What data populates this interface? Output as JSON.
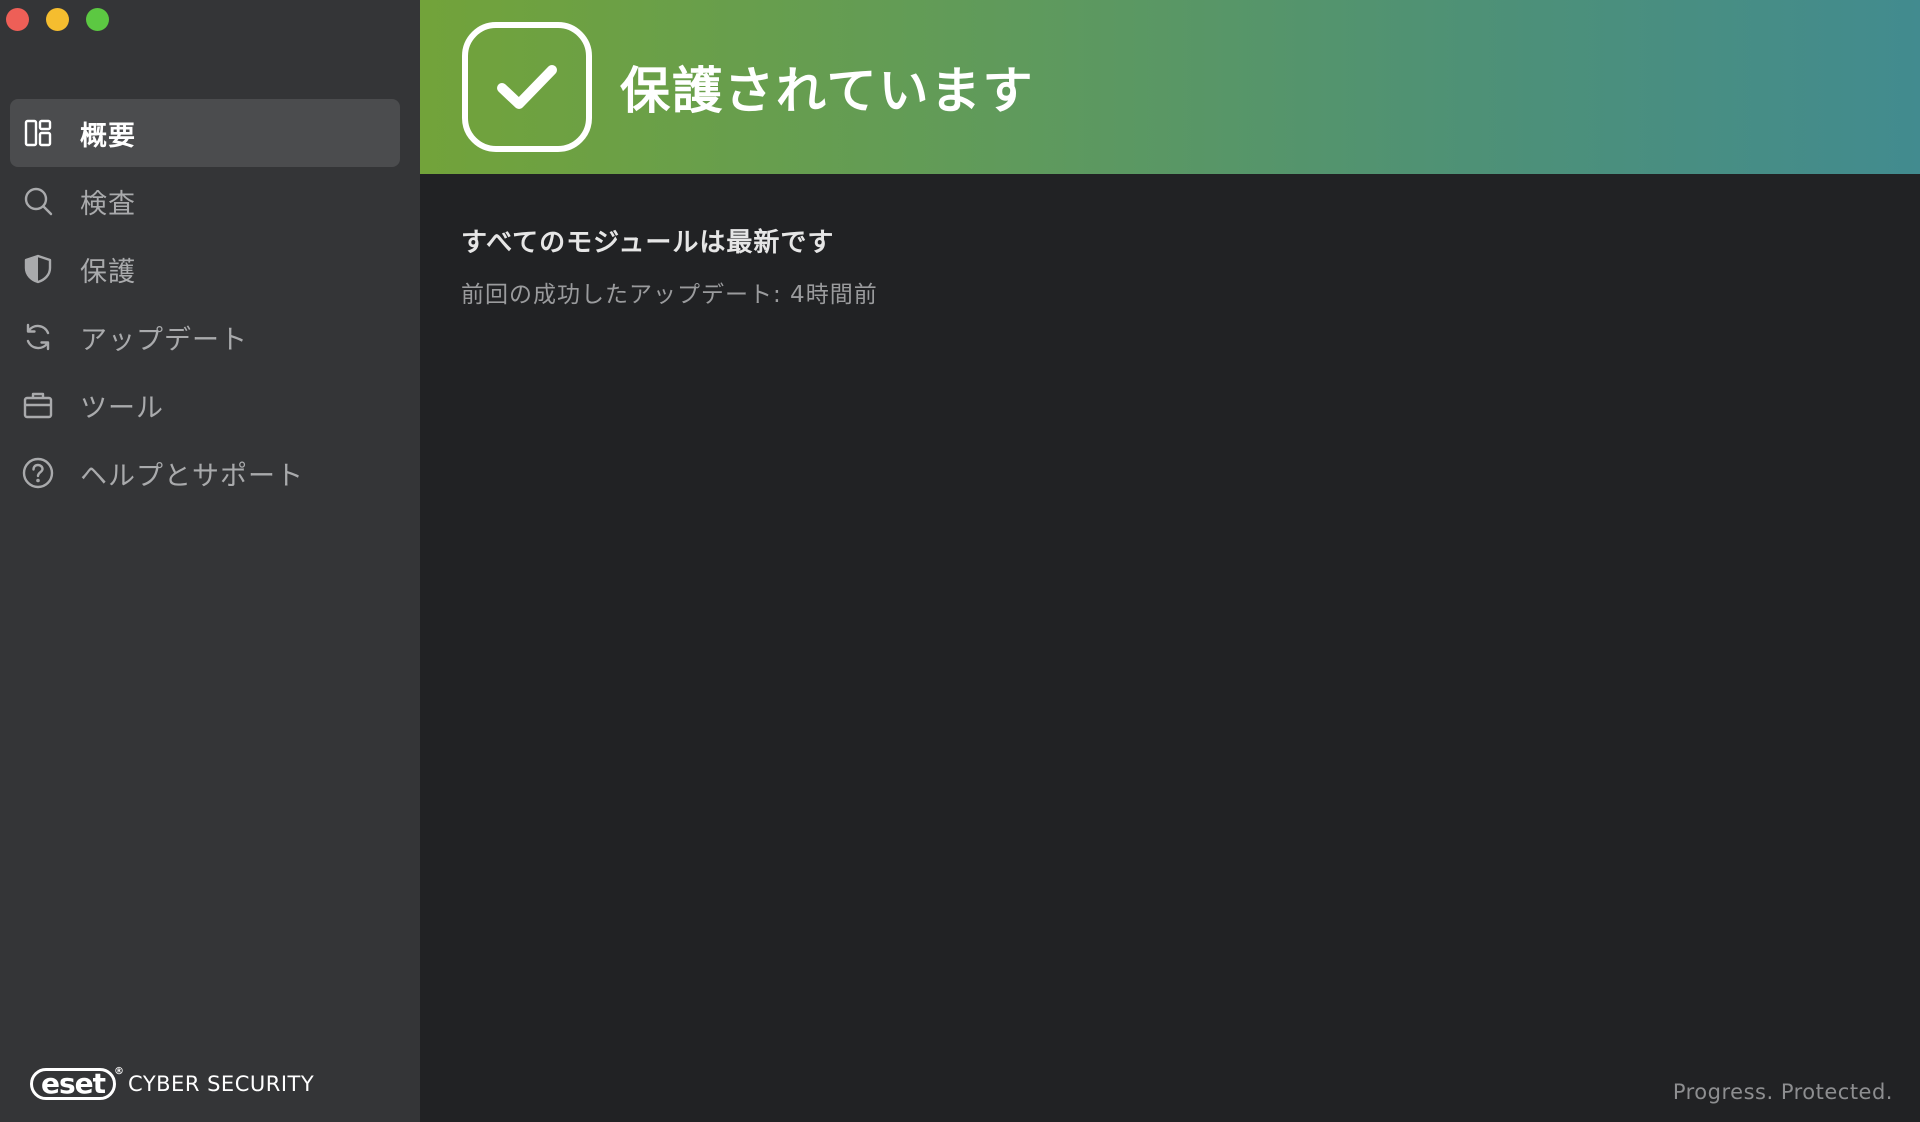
{
  "window": {
    "traffic_lights": {
      "close_color": "#ee5f57",
      "minimize_color": "#f5bd2f",
      "zoom_color": "#5cc842"
    }
  },
  "sidebar": {
    "items": [
      {
        "label": "概要",
        "icon": "dashboard-icon",
        "active": true
      },
      {
        "label": "検査",
        "icon": "search-icon",
        "active": false
      },
      {
        "label": "保護",
        "icon": "shield-icon",
        "active": false
      },
      {
        "label": "アップデート",
        "icon": "refresh-icon",
        "active": false
      },
      {
        "label": "ツール",
        "icon": "toolbox-icon",
        "active": false
      },
      {
        "label": "ヘルプとサポート",
        "icon": "help-icon",
        "active": false
      }
    ],
    "brand": {
      "logo": "eset",
      "product": "CYBER SECURITY"
    }
  },
  "banner": {
    "title": "保護されています",
    "icon": "checkmark-icon",
    "gradient_start": "#72a33a",
    "gradient_end": "#428b8f"
  },
  "status": {
    "title": "すべてのモジュールは最新です",
    "subtitle": "前回の成功したアップデート:  4時間前"
  },
  "footer": {
    "slogan": "Progress. Protected."
  }
}
